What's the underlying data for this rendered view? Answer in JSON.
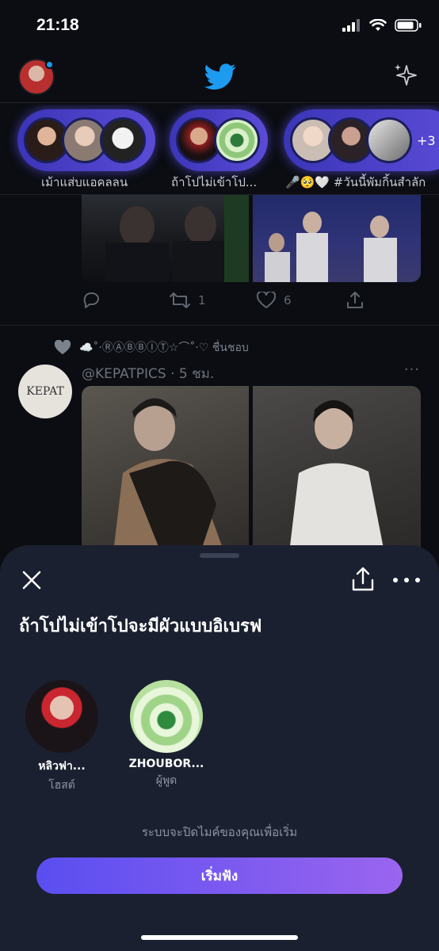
{
  "status_bar": {
    "time": "21:18"
  },
  "spaces": [
    {
      "label": "เม้าแส่บแอคลลน"
    },
    {
      "label": "ถ้าโปไม่เข้าโป..."
    },
    {
      "label": "🎤🥺🤍 #วันนี้พัมกิ้นสำลัก",
      "count": "+3"
    }
  ],
  "feed": {
    "tweet1": {
      "retweets": "1",
      "likes": "6"
    },
    "tweet2": {
      "liked_by": "☁️˚·ⓇⒶⒷⒷⒾⓉ☆⌒˚·♡ ชื่นชอบ",
      "avatar_text": "KEPAT",
      "author": "@KEPATPICS · 5 ชม.",
      "more": "···"
    }
  },
  "sheet": {
    "title": "ถ้าโปไม่เข้าโปจะมีผัวแบบอิเบรฟ",
    "speakers": [
      {
        "name": "หลิวฟา...",
        "role": "โฮสต์"
      },
      {
        "name": "ZHOUBOR...",
        "role": "ผู้พูด"
      }
    ],
    "mic_note": "ระบบจะปิดไมค์ของคุณเพื่อเริ่ม",
    "start_button": "เริ่มฟัง"
  },
  "colors": {
    "accent": "#1d9bf0",
    "button_start": "#5a4ef0",
    "button_end": "#9a65ef",
    "sheet_bg": "#1a2030"
  }
}
